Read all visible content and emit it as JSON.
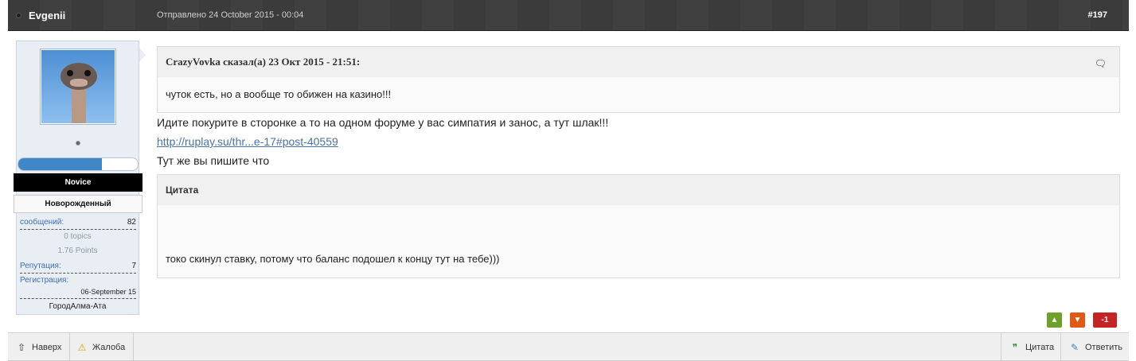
{
  "header": {
    "author": "Evgenii",
    "sent": "Отправлено 24 October 2015 - 00:04",
    "post_number": "#197"
  },
  "user": {
    "rank": "Novice",
    "group": "Новорожденный",
    "reputation_bar_percent": 70,
    "stats": {
      "messages_label": "сообщений:",
      "messages_value": "82",
      "topics": "0 topics",
      "points": "1.76 Points",
      "reputation_label": "Репутация:",
      "reputation_value": "7",
      "registration_label": "Регистрация:",
      "registration_value": "06-September 15",
      "city": "ГородАлма-Ата"
    }
  },
  "post": {
    "quote1": {
      "header": "CrazyVovka сказал(а) 23 Окт 2015 - 21:51:",
      "body": "чуток есть, но а вообще то обижен на казино!!!"
    },
    "line1": "Идите покурите в сторонке а то на одном форуме у вас симпатия и занос, а тут шлак!!!",
    "link": "http://ruplay.su/thr...e-17#post-40559",
    "line2": "Тут же вы пишите что",
    "quote2": {
      "header": "Цитата",
      "body": "токо скинул ставку, потому что баланс подошел к концу тут на тебе)))"
    }
  },
  "votes": {
    "score": "-1"
  },
  "footer": {
    "top": "Наверх",
    "report": "Жалоба",
    "quote": "Цитата",
    "reply": "Ответить"
  },
  "colors": {
    "header_bg": "#3b3b3b",
    "panel_bg": "#e9eef5",
    "link": "#4a72a6",
    "vote_up": "#6da12b",
    "vote_down": "#e05a16",
    "vote_score": "#c62424"
  }
}
